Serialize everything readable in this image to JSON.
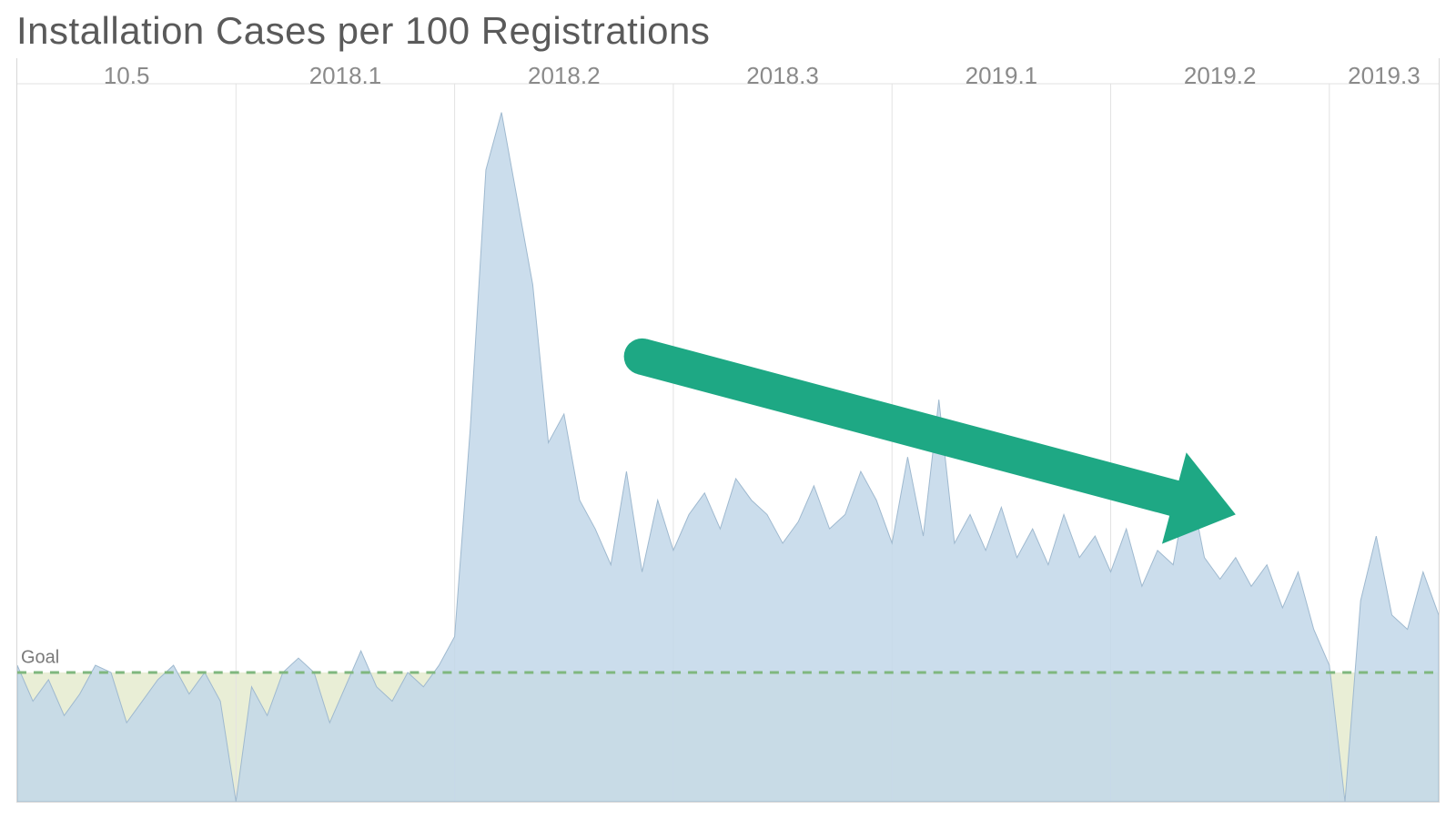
{
  "chart_data": {
    "type": "area",
    "title": "Installation Cases per 100 Registrations",
    "xlabel": "",
    "ylabel": "",
    "ylim": [
      0,
      10
    ],
    "goal": {
      "label": "Goal",
      "value": 1.8
    },
    "sections": [
      {
        "label": "10.5",
        "start": 0,
        "end": 14
      },
      {
        "label": "2018.1",
        "start": 14,
        "end": 28
      },
      {
        "label": "2018.2",
        "start": 28,
        "end": 42
      },
      {
        "label": "2018.3",
        "start": 42,
        "end": 56
      },
      {
        "label": "2019.1",
        "start": 56,
        "end": 70
      },
      {
        "label": "2019.2",
        "start": 70,
        "end": 84
      },
      {
        "label": "2019.3",
        "start": 84,
        "end": 92
      }
    ],
    "values": [
      1.9,
      1.4,
      1.7,
      1.2,
      1.5,
      1.9,
      1.8,
      1.1,
      1.4,
      1.7,
      1.9,
      1.5,
      1.8,
      1.4,
      0.0,
      1.6,
      1.2,
      1.8,
      2.0,
      1.8,
      1.1,
      1.6,
      2.1,
      1.6,
      1.4,
      1.8,
      1.6,
      1.9,
      2.3,
      5.2,
      8.8,
      9.6,
      8.4,
      7.2,
      5.0,
      5.4,
      4.2,
      3.8,
      3.3,
      4.6,
      3.2,
      4.2,
      3.5,
      4.0,
      4.3,
      3.8,
      4.5,
      4.2,
      4.0,
      3.6,
      3.9,
      4.4,
      3.8,
      4.0,
      4.6,
      4.2,
      3.6,
      4.8,
      3.7,
      5.6,
      3.6,
      4.0,
      3.5,
      4.1,
      3.4,
      3.8,
      3.3,
      4.0,
      3.4,
      3.7,
      3.2,
      3.8,
      3.0,
      3.5,
      3.3,
      4.5,
      3.4,
      3.1,
      3.4,
      3.0,
      3.3,
      2.7,
      3.2,
      2.4,
      1.9,
      0.0,
      2.8,
      3.7,
      2.6,
      2.4,
      3.2,
      2.6
    ],
    "trend_arrow": {
      "from": [
        40,
        6.2
      ],
      "to": [
        78,
        4.0
      ]
    },
    "colors": {
      "area_fill": "#c2d7e9",
      "area_stroke": "#9fb9cf",
      "grid": "#e2e2e2",
      "goal_line": "#7fb77e",
      "goal_band": "#e9eed6",
      "arrow": "#1ea884"
    }
  }
}
